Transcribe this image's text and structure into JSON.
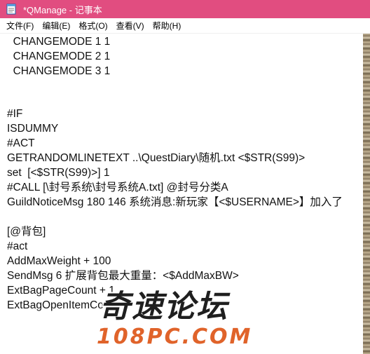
{
  "window": {
    "title": "*QManage - 记事本",
    "accent_color": "#e14d80",
    "icon": "notepad-icon"
  },
  "menu": {
    "items": [
      "文件(F)",
      "编辑(E)",
      "格式(O)",
      "查看(V)",
      "帮助(H)"
    ]
  },
  "editor": {
    "lines": [
      "  CHANGEMODE 1 1",
      "  CHANGEMODE 2 1",
      "  CHANGEMODE 3 1",
      "",
      "",
      "#IF",
      "ISDUMMY",
      "#ACT",
      "GETRANDOMLINETEXT ..\\QuestDiary\\随机.txt <$STR(S99)>",
      "set  [<$STR(S99)>] 1",
      "#CALL [\\封号系统\\封号系统A.txt] @封号分类A",
      "GuildNoticeMsg 180 146 系统消息:新玩家【<$USERNAME>】加入了",
      "",
      "[@背包]",
      "#act",
      "AddMaxWeight + 100",
      "SendMsg 6 扩展背包最大重量：<$AddMaxBW>",
      "ExtBagPageCount + 1",
      "ExtBagOpenItemCount"
    ]
  },
  "watermark": {
    "chinese": "奇速论坛",
    "latin": "108PC.COM"
  }
}
